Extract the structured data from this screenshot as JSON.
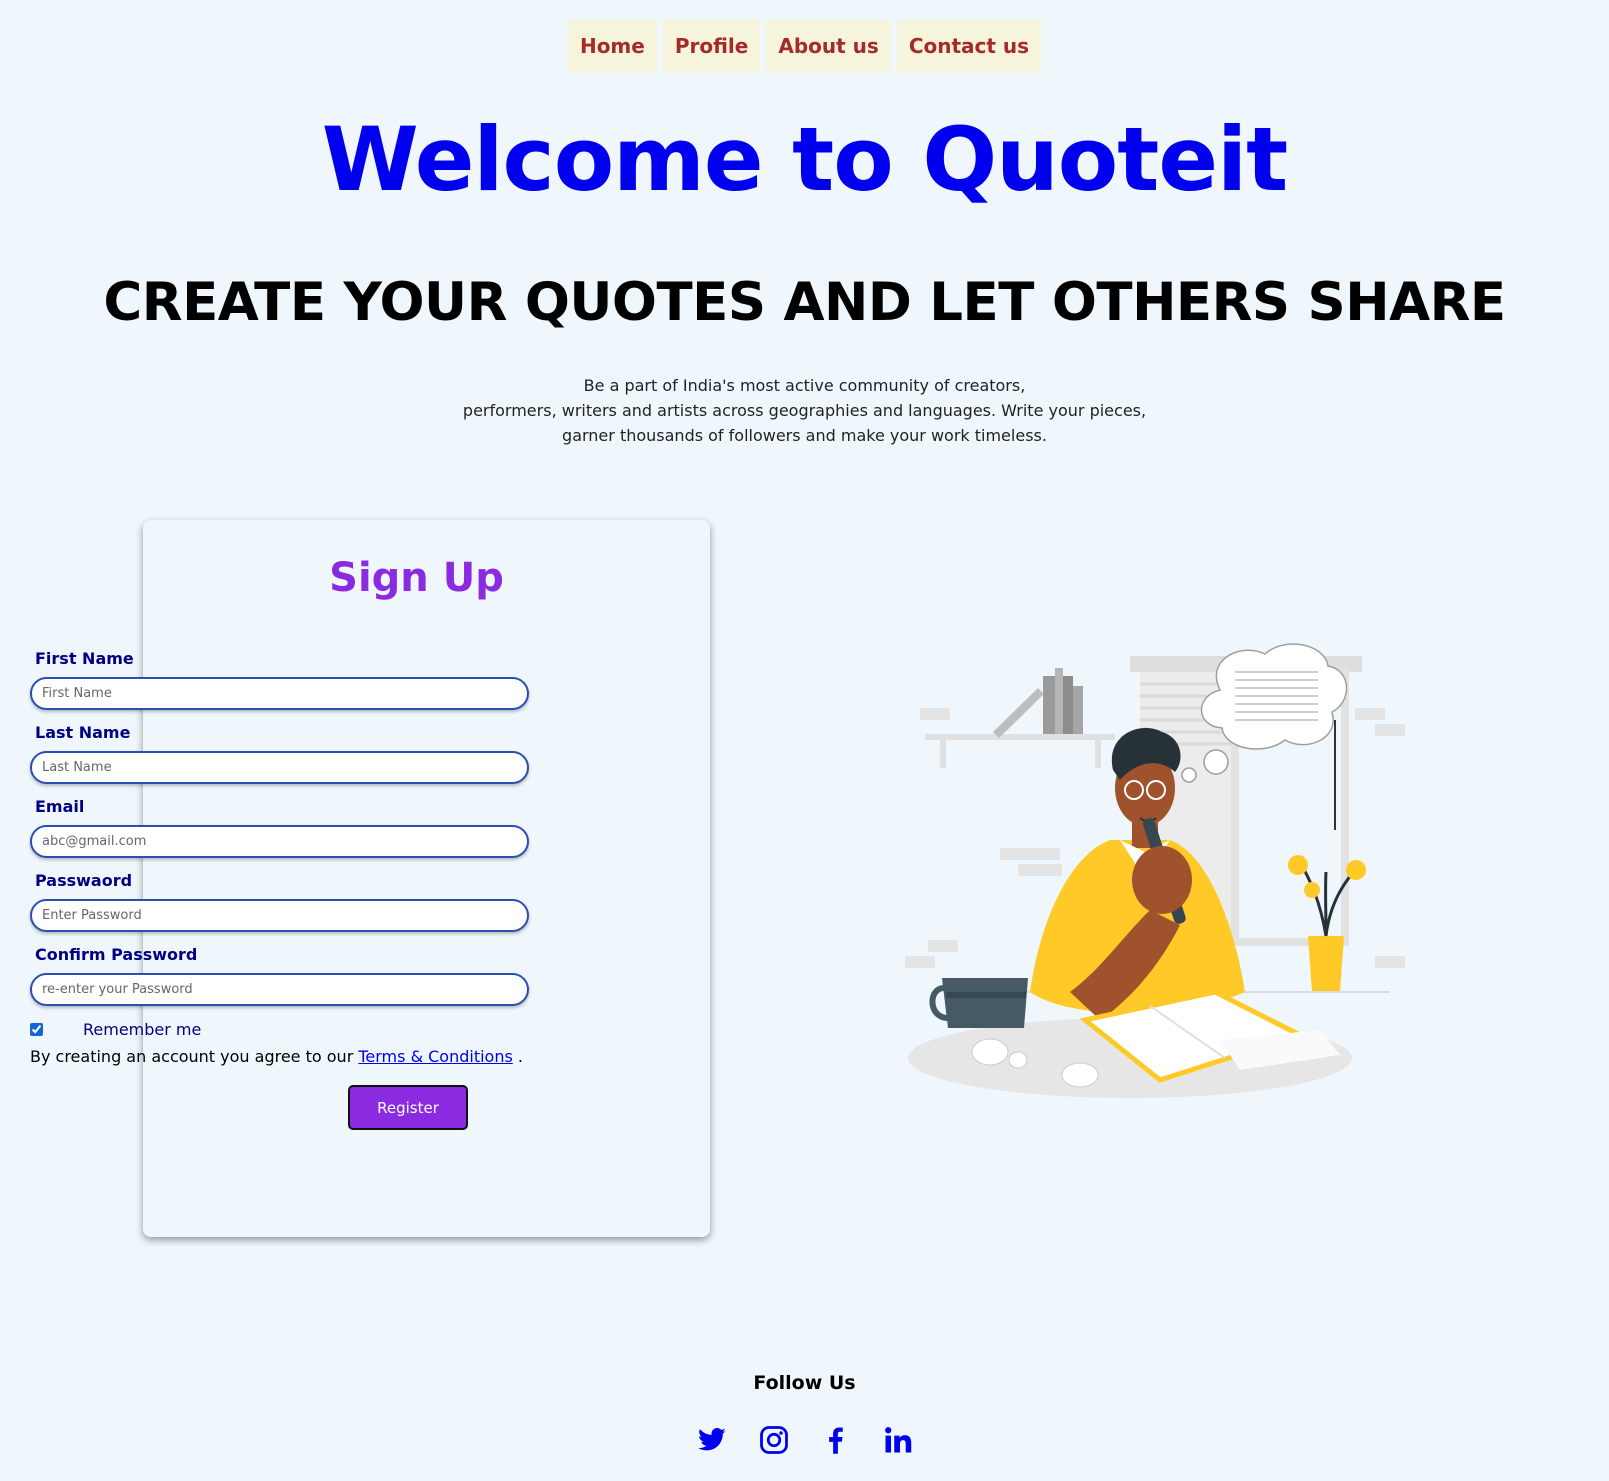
{
  "nav": {
    "items": [
      "Home",
      "Profile",
      "About us",
      "Contact us"
    ]
  },
  "hero": {
    "title": "Welcome to Quoteit",
    "subtitle": "CREATE YOUR QUOTES AND LET OTHERS SHARE",
    "intro_lines": [
      "Be a part of India's most active community of creators,",
      "performers, writers and artists across geographies and languages. Write your pieces,",
      "garner thousands of followers and make your work timeless."
    ]
  },
  "signup": {
    "title": "Sign Up",
    "fields": [
      {
        "label": "First Name",
        "placeholder": "First Name"
      },
      {
        "label": "Last Name",
        "placeholder": "Last Name"
      },
      {
        "label": "Email",
        "placeholder": "abc@gmail.com"
      },
      {
        "label": "Passwaord",
        "placeholder": "Enter Password"
      },
      {
        "label": "Confirm Password",
        "placeholder": "re-enter your Password"
      }
    ],
    "remember_label": "Remember me",
    "remember_checked": true,
    "terms_prefix": "By creating an account you agree to our",
    "terms_link": "Terms & Conditions",
    "terms_suffix": ".",
    "register_label": "Register"
  },
  "footer": {
    "follow_label": "Follow Us",
    "social_icons": [
      "twitter-icon",
      "instagram-icon",
      "facebook-icon",
      "linkedin-icon"
    ],
    "icon_color": "#0000ee"
  },
  "colors": {
    "background": "#eff7fd",
    "title": "#0000ee",
    "nav_text": "#a52a2a",
    "nav_bg": "#f7f4dc",
    "accent": "#8a2be2",
    "label": "#000080"
  }
}
